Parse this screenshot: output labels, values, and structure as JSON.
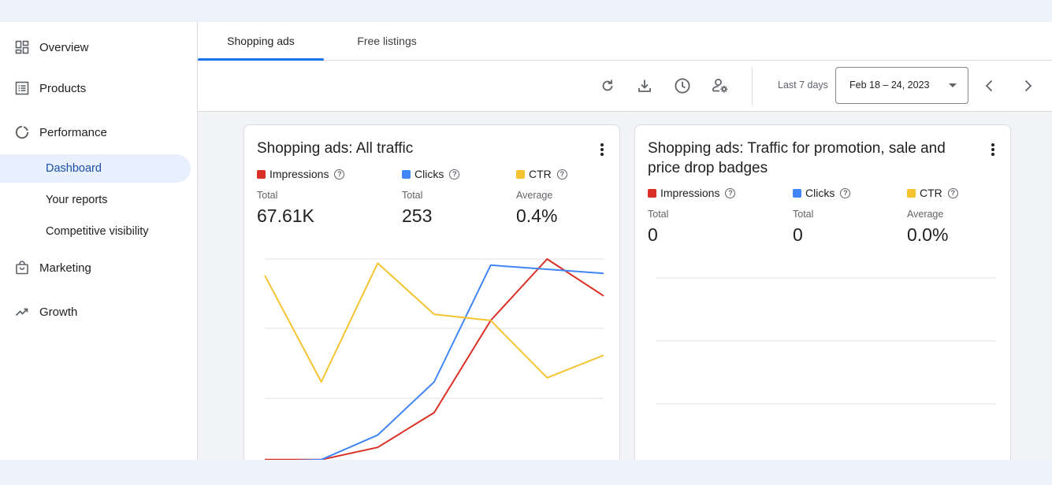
{
  "sidebar": {
    "items": [
      {
        "label": "Overview",
        "icon": "dashboard-icon"
      },
      {
        "label": "Products",
        "icon": "list-icon"
      },
      {
        "label": "Performance",
        "icon": "donut-chart-icon"
      },
      {
        "label": "Marketing",
        "icon": "shopping-bag-icon"
      },
      {
        "label": "Growth",
        "icon": "trending-up-icon"
      }
    ],
    "performance_sub": [
      {
        "label": "Dashboard",
        "active": true
      },
      {
        "label": "Your reports",
        "active": false
      },
      {
        "label": "Competitive visibility",
        "active": false
      }
    ]
  },
  "tabs": [
    {
      "label": "Shopping ads",
      "active": true
    },
    {
      "label": "Free listings",
      "active": false
    }
  ],
  "toolbar": {
    "icons": [
      "refresh-icon",
      "download-icon",
      "history-icon",
      "manage-accounts-icon"
    ],
    "range_label": "Last 7 days",
    "date_range": "Feb 18 – 24, 2023"
  },
  "colors": {
    "impressions": "#d93025",
    "clicks": "#4285f4",
    "ctr": "#f4c430",
    "accent": "#1a73e8"
  },
  "cards": [
    {
      "title": "Shopping ads: All traffic",
      "metrics": [
        {
          "name": "Impressions",
          "sub": "Total",
          "value": "67.61K"
        },
        {
          "name": "Clicks",
          "sub": "Total",
          "value": "253"
        },
        {
          "name": "CTR",
          "sub": "Average",
          "value": "0.4%"
        }
      ]
    },
    {
      "title": "Shopping ads: Traffic for promotion, sale and price drop badges",
      "metrics": [
        {
          "name": "Impressions",
          "sub": "Total",
          "value": "0"
        },
        {
          "name": "Clicks",
          "sub": "Total",
          "value": "0"
        },
        {
          "name": "CTR",
          "sub": "Average",
          "value": "0.0%"
        }
      ]
    }
  ],
  "chart_data": [
    {
      "type": "line",
      "title": "Shopping ads: All traffic",
      "x": [
        1,
        2,
        3,
        4,
        5,
        6,
        7
      ],
      "series": [
        {
          "name": "Impressions",
          "values": [
            0.02,
            0.02,
            0.08,
            0.25,
            0.7,
            1.0,
            0.82
          ]
        },
        {
          "name": "Clicks",
          "values": [
            0.01,
            0.02,
            0.14,
            0.4,
            0.97,
            0.95,
            0.93
          ]
        },
        {
          "name": "CTR",
          "values": [
            0.92,
            0.4,
            0.98,
            0.73,
            0.7,
            0.42,
            0.53
          ]
        }
      ],
      "ylim": [
        0,
        1
      ],
      "grid": true,
      "legend": "top"
    },
    {
      "type": "line",
      "title": "Shopping ads: Traffic for promotion, sale and price drop badges",
      "x": [],
      "series": [],
      "grid": true
    }
  ]
}
